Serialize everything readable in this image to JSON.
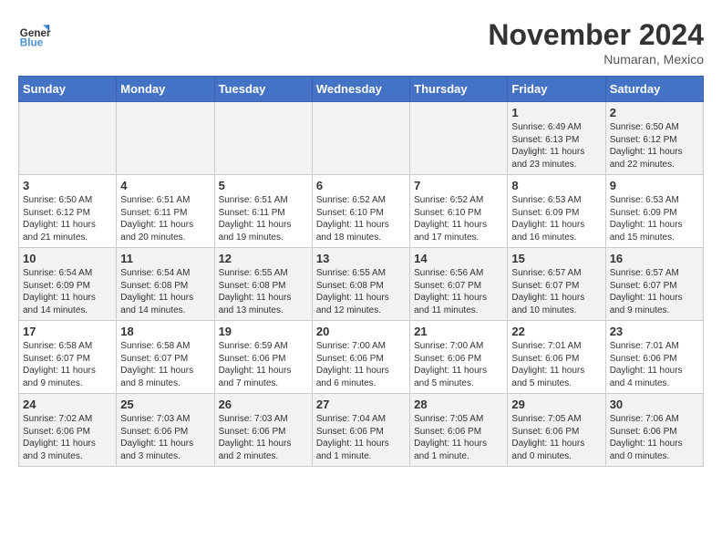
{
  "logo": {
    "line1": "General",
    "line2": "Blue"
  },
  "title": "November 2024",
  "location": "Numaran, Mexico",
  "days_of_week": [
    "Sunday",
    "Monday",
    "Tuesday",
    "Wednesday",
    "Thursday",
    "Friday",
    "Saturday"
  ],
  "weeks": [
    [
      {
        "day": "",
        "info": ""
      },
      {
        "day": "",
        "info": ""
      },
      {
        "day": "",
        "info": ""
      },
      {
        "day": "",
        "info": ""
      },
      {
        "day": "",
        "info": ""
      },
      {
        "day": "1",
        "info": "Sunrise: 6:49 AM\nSunset: 6:13 PM\nDaylight: 11 hours and 23 minutes."
      },
      {
        "day": "2",
        "info": "Sunrise: 6:50 AM\nSunset: 6:12 PM\nDaylight: 11 hours and 22 minutes."
      }
    ],
    [
      {
        "day": "3",
        "info": "Sunrise: 6:50 AM\nSunset: 6:12 PM\nDaylight: 11 hours and 21 minutes."
      },
      {
        "day": "4",
        "info": "Sunrise: 6:51 AM\nSunset: 6:11 PM\nDaylight: 11 hours and 20 minutes."
      },
      {
        "day": "5",
        "info": "Sunrise: 6:51 AM\nSunset: 6:11 PM\nDaylight: 11 hours and 19 minutes."
      },
      {
        "day": "6",
        "info": "Sunrise: 6:52 AM\nSunset: 6:10 PM\nDaylight: 11 hours and 18 minutes."
      },
      {
        "day": "7",
        "info": "Sunrise: 6:52 AM\nSunset: 6:10 PM\nDaylight: 11 hours and 17 minutes."
      },
      {
        "day": "8",
        "info": "Sunrise: 6:53 AM\nSunset: 6:09 PM\nDaylight: 11 hours and 16 minutes."
      },
      {
        "day": "9",
        "info": "Sunrise: 6:53 AM\nSunset: 6:09 PM\nDaylight: 11 hours and 15 minutes."
      }
    ],
    [
      {
        "day": "10",
        "info": "Sunrise: 6:54 AM\nSunset: 6:09 PM\nDaylight: 11 hours and 14 minutes."
      },
      {
        "day": "11",
        "info": "Sunrise: 6:54 AM\nSunset: 6:08 PM\nDaylight: 11 hours and 14 minutes."
      },
      {
        "day": "12",
        "info": "Sunrise: 6:55 AM\nSunset: 6:08 PM\nDaylight: 11 hours and 13 minutes."
      },
      {
        "day": "13",
        "info": "Sunrise: 6:55 AM\nSunset: 6:08 PM\nDaylight: 11 hours and 12 minutes."
      },
      {
        "day": "14",
        "info": "Sunrise: 6:56 AM\nSunset: 6:07 PM\nDaylight: 11 hours and 11 minutes."
      },
      {
        "day": "15",
        "info": "Sunrise: 6:57 AM\nSunset: 6:07 PM\nDaylight: 11 hours and 10 minutes."
      },
      {
        "day": "16",
        "info": "Sunrise: 6:57 AM\nSunset: 6:07 PM\nDaylight: 11 hours and 9 minutes."
      }
    ],
    [
      {
        "day": "17",
        "info": "Sunrise: 6:58 AM\nSunset: 6:07 PM\nDaylight: 11 hours and 9 minutes."
      },
      {
        "day": "18",
        "info": "Sunrise: 6:58 AM\nSunset: 6:07 PM\nDaylight: 11 hours and 8 minutes."
      },
      {
        "day": "19",
        "info": "Sunrise: 6:59 AM\nSunset: 6:06 PM\nDaylight: 11 hours and 7 minutes."
      },
      {
        "day": "20",
        "info": "Sunrise: 7:00 AM\nSunset: 6:06 PM\nDaylight: 11 hours and 6 minutes."
      },
      {
        "day": "21",
        "info": "Sunrise: 7:00 AM\nSunset: 6:06 PM\nDaylight: 11 hours and 5 minutes."
      },
      {
        "day": "22",
        "info": "Sunrise: 7:01 AM\nSunset: 6:06 PM\nDaylight: 11 hours and 5 minutes."
      },
      {
        "day": "23",
        "info": "Sunrise: 7:01 AM\nSunset: 6:06 PM\nDaylight: 11 hours and 4 minutes."
      }
    ],
    [
      {
        "day": "24",
        "info": "Sunrise: 7:02 AM\nSunset: 6:06 PM\nDaylight: 11 hours and 3 minutes."
      },
      {
        "day": "25",
        "info": "Sunrise: 7:03 AM\nSunset: 6:06 PM\nDaylight: 11 hours and 3 minutes."
      },
      {
        "day": "26",
        "info": "Sunrise: 7:03 AM\nSunset: 6:06 PM\nDaylight: 11 hours and 2 minutes."
      },
      {
        "day": "27",
        "info": "Sunrise: 7:04 AM\nSunset: 6:06 PM\nDaylight: 11 hours and 1 minute."
      },
      {
        "day": "28",
        "info": "Sunrise: 7:05 AM\nSunset: 6:06 PM\nDaylight: 11 hours and 1 minute."
      },
      {
        "day": "29",
        "info": "Sunrise: 7:05 AM\nSunset: 6:06 PM\nDaylight: 11 hours and 0 minutes."
      },
      {
        "day": "30",
        "info": "Sunrise: 7:06 AM\nSunset: 6:06 PM\nDaylight: 11 hours and 0 minutes."
      }
    ]
  ]
}
